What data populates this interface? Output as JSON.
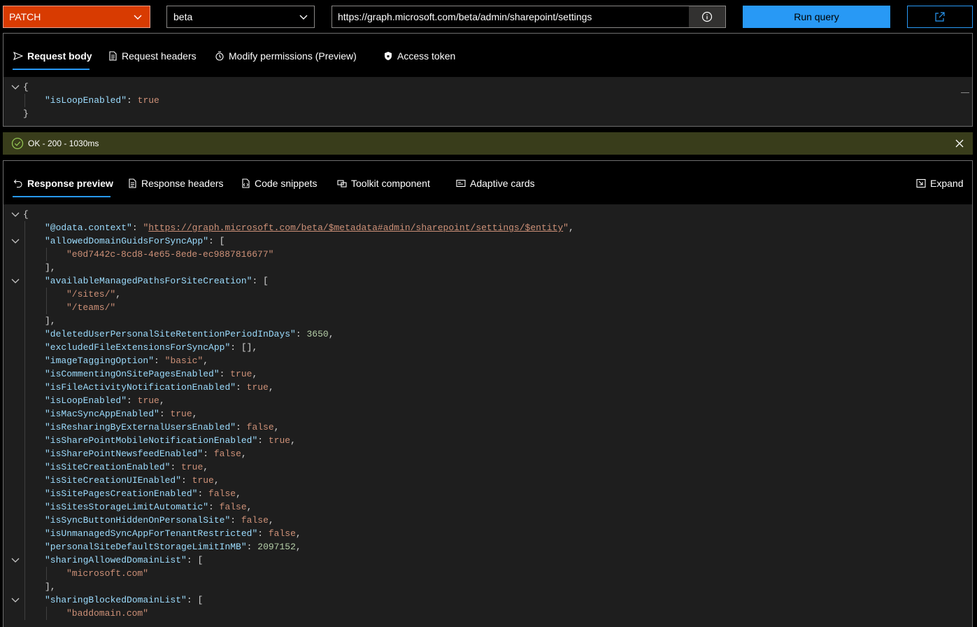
{
  "query": {
    "method": "PATCH",
    "version": "beta",
    "url": "https://graph.microsoft.com/beta/admin/sharepoint/settings",
    "run_label": "Run query"
  },
  "request_tabs": [
    {
      "label": "Request body",
      "icon": "send-icon"
    },
    {
      "label": "Request headers",
      "icon": "document-icon"
    },
    {
      "label": "Modify permissions (Preview)",
      "icon": "permissions-icon"
    },
    {
      "label": "Access token",
      "icon": "shield-lock-icon"
    }
  ],
  "request_body": {
    "open": "{",
    "key": "\"isLoopEnabled\"",
    "value": "true",
    "close": "}"
  },
  "status": {
    "message": "OK - 200 - 1030ms",
    "color": "#393d1b"
  },
  "response_tabs": [
    {
      "label": "Response preview",
      "icon": "undo-icon"
    },
    {
      "label": "Response headers",
      "icon": "document-icon"
    },
    {
      "label": "Code snippets",
      "icon": "code-file-icon"
    },
    {
      "label": "Toolkit component",
      "icon": "toolkit-icon"
    },
    {
      "label": "Adaptive cards",
      "icon": "card-icon"
    }
  ],
  "expand_label": "Expand",
  "response_lines": [
    {
      "indent": 0,
      "fold": true,
      "parts": [
        {
          "t": "p",
          "v": "{"
        }
      ]
    },
    {
      "indent": 1,
      "fold": false,
      "parts": [
        {
          "t": "k",
          "v": "\"@odata.context\""
        },
        {
          "t": "p",
          "v": ": "
        },
        {
          "t": "s",
          "v": "\""
        },
        {
          "t": "link",
          "v": "https://graph.microsoft.com/beta/$metadata#admin/sharepoint/settings/$entity"
        },
        {
          "t": "s",
          "v": "\""
        },
        {
          "t": "p",
          "v": ","
        }
      ]
    },
    {
      "indent": 1,
      "fold": true,
      "parts": [
        {
          "t": "k",
          "v": "\"allowedDomainGuidsForSyncApp\""
        },
        {
          "t": "p",
          "v": ": ["
        }
      ]
    },
    {
      "indent": 2,
      "fold": false,
      "parts": [
        {
          "t": "s",
          "v": "\"e0d7442c-8cd8-4e65-8ede-ec9887816677\""
        }
      ]
    },
    {
      "indent": 1,
      "fold": false,
      "parts": [
        {
          "t": "p",
          "v": "],"
        }
      ]
    },
    {
      "indent": 1,
      "fold": true,
      "parts": [
        {
          "t": "k",
          "v": "\"availableManagedPathsForSiteCreation\""
        },
        {
          "t": "p",
          "v": ": ["
        }
      ]
    },
    {
      "indent": 2,
      "fold": false,
      "parts": [
        {
          "t": "s",
          "v": "\"/sites/\""
        },
        {
          "t": "p",
          "v": ","
        }
      ]
    },
    {
      "indent": 2,
      "fold": false,
      "parts": [
        {
          "t": "s",
          "v": "\"/teams/\""
        }
      ]
    },
    {
      "indent": 1,
      "fold": false,
      "parts": [
        {
          "t": "p",
          "v": "],"
        }
      ]
    },
    {
      "indent": 1,
      "fold": false,
      "parts": [
        {
          "t": "k",
          "v": "\"deletedUserPersonalSiteRetentionPeriodInDays\""
        },
        {
          "t": "p",
          "v": ": "
        },
        {
          "t": "n",
          "v": "3650"
        },
        {
          "t": "p",
          "v": ","
        }
      ]
    },
    {
      "indent": 1,
      "fold": false,
      "parts": [
        {
          "t": "k",
          "v": "\"excludedFileExtensionsForSyncApp\""
        },
        {
          "t": "p",
          "v": ": [],"
        }
      ]
    },
    {
      "indent": 1,
      "fold": false,
      "parts": [
        {
          "t": "k",
          "v": "\"imageTaggingOption\""
        },
        {
          "t": "p",
          "v": ": "
        },
        {
          "t": "s",
          "v": "\"basic\""
        },
        {
          "t": "p",
          "v": ","
        }
      ]
    },
    {
      "indent": 1,
      "fold": false,
      "parts": [
        {
          "t": "k",
          "v": "\"isCommentingOnSitePagesEnabled\""
        },
        {
          "t": "p",
          "v": ": "
        },
        {
          "t": "b",
          "v": "true"
        },
        {
          "t": "p",
          "v": ","
        }
      ]
    },
    {
      "indent": 1,
      "fold": false,
      "parts": [
        {
          "t": "k",
          "v": "\"isFileActivityNotificationEnabled\""
        },
        {
          "t": "p",
          "v": ": "
        },
        {
          "t": "b",
          "v": "true"
        },
        {
          "t": "p",
          "v": ","
        }
      ]
    },
    {
      "indent": 1,
      "fold": false,
      "parts": [
        {
          "t": "k",
          "v": "\"isLoopEnabled\""
        },
        {
          "t": "p",
          "v": ": "
        },
        {
          "t": "b",
          "v": "true"
        },
        {
          "t": "p",
          "v": ","
        }
      ]
    },
    {
      "indent": 1,
      "fold": false,
      "parts": [
        {
          "t": "k",
          "v": "\"isMacSyncAppEnabled\""
        },
        {
          "t": "p",
          "v": ": "
        },
        {
          "t": "b",
          "v": "true"
        },
        {
          "t": "p",
          "v": ","
        }
      ]
    },
    {
      "indent": 1,
      "fold": false,
      "parts": [
        {
          "t": "k",
          "v": "\"isResharingByExternalUsersEnabled\""
        },
        {
          "t": "p",
          "v": ": "
        },
        {
          "t": "b",
          "v": "false"
        },
        {
          "t": "p",
          "v": ","
        }
      ]
    },
    {
      "indent": 1,
      "fold": false,
      "parts": [
        {
          "t": "k",
          "v": "\"isSharePointMobileNotificationEnabled\""
        },
        {
          "t": "p",
          "v": ": "
        },
        {
          "t": "b",
          "v": "true"
        },
        {
          "t": "p",
          "v": ","
        }
      ]
    },
    {
      "indent": 1,
      "fold": false,
      "parts": [
        {
          "t": "k",
          "v": "\"isSharePointNewsfeedEnabled\""
        },
        {
          "t": "p",
          "v": ": "
        },
        {
          "t": "b",
          "v": "false"
        },
        {
          "t": "p",
          "v": ","
        }
      ]
    },
    {
      "indent": 1,
      "fold": false,
      "parts": [
        {
          "t": "k",
          "v": "\"isSiteCreationEnabled\""
        },
        {
          "t": "p",
          "v": ": "
        },
        {
          "t": "b",
          "v": "true"
        },
        {
          "t": "p",
          "v": ","
        }
      ]
    },
    {
      "indent": 1,
      "fold": false,
      "parts": [
        {
          "t": "k",
          "v": "\"isSiteCreationUIEnabled\""
        },
        {
          "t": "p",
          "v": ": "
        },
        {
          "t": "b",
          "v": "true"
        },
        {
          "t": "p",
          "v": ","
        }
      ]
    },
    {
      "indent": 1,
      "fold": false,
      "parts": [
        {
          "t": "k",
          "v": "\"isSitePagesCreationEnabled\""
        },
        {
          "t": "p",
          "v": ": "
        },
        {
          "t": "b",
          "v": "false"
        },
        {
          "t": "p",
          "v": ","
        }
      ]
    },
    {
      "indent": 1,
      "fold": false,
      "parts": [
        {
          "t": "k",
          "v": "\"isSitesStorageLimitAutomatic\""
        },
        {
          "t": "p",
          "v": ": "
        },
        {
          "t": "b",
          "v": "false"
        },
        {
          "t": "p",
          "v": ","
        }
      ]
    },
    {
      "indent": 1,
      "fold": false,
      "parts": [
        {
          "t": "k",
          "v": "\"isSyncButtonHiddenOnPersonalSite\""
        },
        {
          "t": "p",
          "v": ": "
        },
        {
          "t": "b",
          "v": "false"
        },
        {
          "t": "p",
          "v": ","
        }
      ]
    },
    {
      "indent": 1,
      "fold": false,
      "parts": [
        {
          "t": "k",
          "v": "\"isUnmanagedSyncAppForTenantRestricted\""
        },
        {
          "t": "p",
          "v": ": "
        },
        {
          "t": "b",
          "v": "false"
        },
        {
          "t": "p",
          "v": ","
        }
      ]
    },
    {
      "indent": 1,
      "fold": false,
      "parts": [
        {
          "t": "k",
          "v": "\"personalSiteDefaultStorageLimitInMB\""
        },
        {
          "t": "p",
          "v": ": "
        },
        {
          "t": "n",
          "v": "2097152"
        },
        {
          "t": "p",
          "v": ","
        }
      ]
    },
    {
      "indent": 1,
      "fold": true,
      "parts": [
        {
          "t": "k",
          "v": "\"sharingAllowedDomainList\""
        },
        {
          "t": "p",
          "v": ": ["
        }
      ]
    },
    {
      "indent": 2,
      "fold": false,
      "parts": [
        {
          "t": "s",
          "v": "\"microsoft.com\""
        }
      ]
    },
    {
      "indent": 1,
      "fold": false,
      "parts": [
        {
          "t": "p",
          "v": "],"
        }
      ]
    },
    {
      "indent": 1,
      "fold": true,
      "parts": [
        {
          "t": "k",
          "v": "\"sharingBlockedDomainList\""
        },
        {
          "t": "p",
          "v": ": ["
        }
      ]
    },
    {
      "indent": 2,
      "fold": false,
      "parts": [
        {
          "t": "s",
          "v": "\"baddomain.com\""
        }
      ]
    }
  ]
}
